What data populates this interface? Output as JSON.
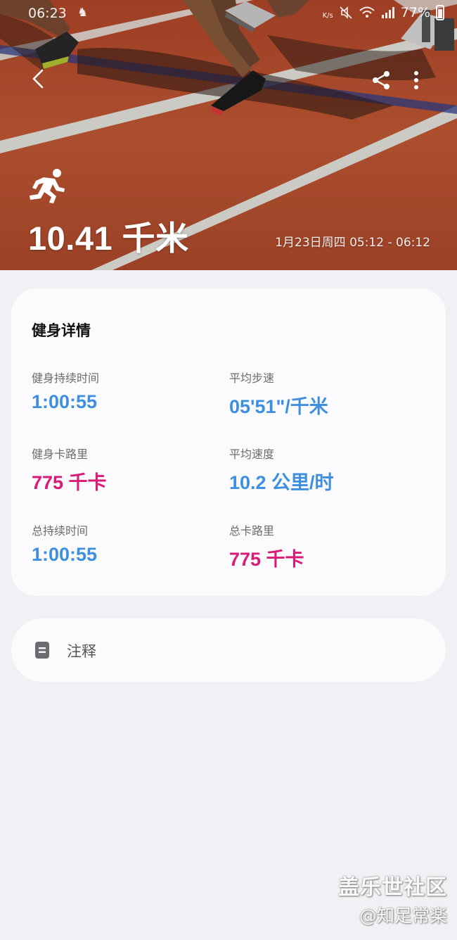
{
  "status_bar": {
    "time": "06:23",
    "net_speed_unit": "K/s",
    "battery": "77%"
  },
  "header": {
    "distance": "10.41 千米",
    "date_range": "1月23日周四 05:12 - 06:12"
  },
  "details": {
    "title": "健身详情",
    "metrics": [
      {
        "label": "健身持续时间",
        "value": "1:00:55",
        "color": "#3e8fe0"
      },
      {
        "label": "平均步速",
        "value": "05'51\"/千米",
        "color": "#3e8fe0"
      },
      {
        "label": "健身卡路里",
        "value": "775 千卡",
        "color": "#d91a76"
      },
      {
        "label": "平均速度",
        "value": "10.2 公里/时",
        "color": "#3e8fe0"
      },
      {
        "label": "总持续时间",
        "value": "1:00:55",
        "color": "#3e8fe0"
      },
      {
        "label": "总卡路里",
        "value": "775 千卡",
        "color": "#d91a76"
      }
    ]
  },
  "notes": {
    "label": "注释"
  },
  "watermark": {
    "line1": "盖乐世社区",
    "line2": "@知足常楽"
  },
  "icons": {
    "back": "chevron-left-icon",
    "share": "share-icon",
    "more": "more-vertical-icon",
    "exercise": "running-icon",
    "notes": "note-icon"
  }
}
